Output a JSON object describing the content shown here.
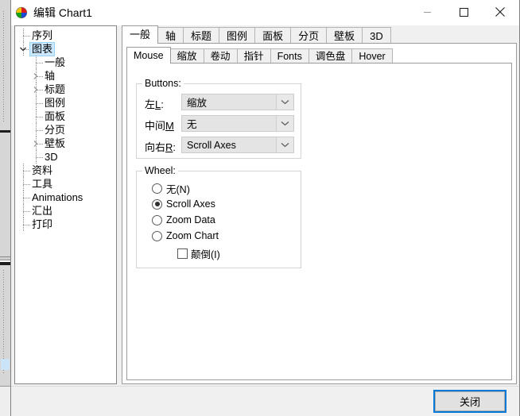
{
  "window": {
    "title": "编辑 Chart1",
    "icon": "pie-chart-icon",
    "controls": {
      "minimize": "minimize-icon",
      "maximize": "maximize-icon",
      "close": "close-icon"
    }
  },
  "tree": {
    "items": [
      {
        "label": "序列",
        "level": 1,
        "expander": "none"
      },
      {
        "label": "图表",
        "level": 1,
        "expander": "expanded",
        "selected": true
      },
      {
        "label": "一般",
        "level": 2,
        "expander": "none"
      },
      {
        "label": "轴",
        "level": 2,
        "expander": "collapsed"
      },
      {
        "label": "标题",
        "level": 2,
        "expander": "collapsed"
      },
      {
        "label": "图例",
        "level": 2,
        "expander": "none"
      },
      {
        "label": "面板",
        "level": 2,
        "expander": "none"
      },
      {
        "label": "分页",
        "level": 2,
        "expander": "none"
      },
      {
        "label": "壁板",
        "level": 2,
        "expander": "collapsed"
      },
      {
        "label": "3D",
        "level": 2,
        "expander": "none"
      },
      {
        "label": "资料",
        "level": 1,
        "expander": "none"
      },
      {
        "label": "工具",
        "level": 1,
        "expander": "none"
      },
      {
        "label": "Animations",
        "level": 1,
        "expander": "none"
      },
      {
        "label": "汇出",
        "level": 1,
        "expander": "none"
      },
      {
        "label": "打印",
        "level": 1,
        "expander": "none"
      }
    ]
  },
  "outer_tabs": {
    "active_index": 0,
    "items": [
      {
        "label": "一般"
      },
      {
        "label": "轴"
      },
      {
        "label": "标题"
      },
      {
        "label": "图例"
      },
      {
        "label": "面板"
      },
      {
        "label": "分页"
      },
      {
        "label": "壁板"
      },
      {
        "label": "3D"
      }
    ]
  },
  "inner_tabs": {
    "active_index": 0,
    "items": [
      {
        "label": "Mouse"
      },
      {
        "label": "缩放"
      },
      {
        "label": "卷动"
      },
      {
        "label": "指针"
      },
      {
        "label": "Fonts"
      },
      {
        "label": "调色盘"
      },
      {
        "label": "Hover"
      }
    ]
  },
  "mouse_panel": {
    "buttons_group": {
      "title": "Buttons:",
      "rows": [
        {
          "label_pre": "左",
          "accel": "L",
          "label_post": ":",
          "value": "缩放"
        },
        {
          "label_pre": "中间",
          "accel": "M",
          "label_post": "",
          "value": "无"
        },
        {
          "label_pre": "向右",
          "accel": "R",
          "label_post": ":",
          "value": "Scroll Axes"
        }
      ]
    },
    "wheel_group": {
      "title": "Wheel:",
      "options": [
        {
          "label": "无(N)",
          "selected": false
        },
        {
          "label": "Scroll Axes",
          "selected": true
        },
        {
          "label": "Zoom Data",
          "selected": false
        },
        {
          "label": "Zoom Chart",
          "selected": false
        }
      ],
      "invert_checkbox": {
        "label": "颠倒(I)",
        "checked": false
      }
    }
  },
  "footer": {
    "close_label": "关闭"
  },
  "colors": {
    "accent": "#0078d7",
    "selection": "#cce8ff",
    "dialog_bg": "#f0f0f0"
  }
}
